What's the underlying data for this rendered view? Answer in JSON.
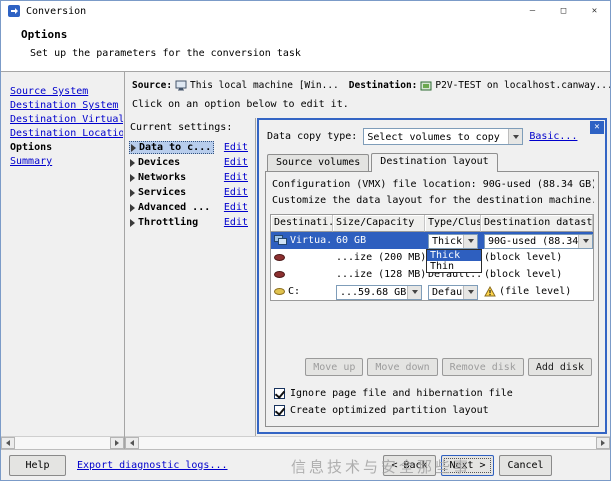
{
  "window": {
    "title": "Conversion",
    "controls": {
      "minimize": "–",
      "maximize": "□",
      "close": "✕"
    }
  },
  "header": {
    "title": "Options",
    "subtitle": "Set up the parameters for the conversion task"
  },
  "sidebar": {
    "items": [
      {
        "label": "Source System"
      },
      {
        "label": "Destination System"
      },
      {
        "label": "Destination Virtual M"
      },
      {
        "label": "Destination Location"
      },
      {
        "label": "Options",
        "current": true
      },
      {
        "label": "Summary"
      }
    ]
  },
  "main": {
    "source_label": "Source:",
    "source_value": "This local machine [Win...",
    "destination_label": "Destination:",
    "destination_value": "P2V-TEST on localhost.canway...",
    "instruction": "Click on an option below to edit it.",
    "settings": {
      "title": "Current settings:",
      "edit_label": "Edit",
      "items": [
        {
          "label": "Data to c...",
          "selected": true
        },
        {
          "label": "Devices"
        },
        {
          "label": "Networks"
        },
        {
          "label": "Services"
        },
        {
          "label": "Advanced ..."
        },
        {
          "label": "Throttling"
        }
      ]
    }
  },
  "panel": {
    "close_glyph": "✕",
    "data_copy_label": "Data copy type:",
    "data_copy_value": "Select volumes to copy",
    "basic_link": "Basic...",
    "tabs": [
      {
        "label": "Source volumes"
      },
      {
        "label": "Destination layout",
        "active": true
      }
    ],
    "config_line": "Configuration (VMX) file location: 90G-used (88.34 GB)",
    "customize_line": "Customize the data layout for the destination machine.",
    "table": {
      "headers": [
        "Destinati...",
        "Size/Capacity",
        "Type/Clus...",
        "Destination datast..."
      ],
      "rows": [
        {
          "name": "Virtua...",
          "size": "60 GB",
          "type": "Thick",
          "datastore": "90G-used (88.34...",
          "selected": true
        },
        {
          "name": "",
          "size": "...ize (200 MB)",
          "type": "",
          "datastore": "(block level)"
        },
        {
          "name": "",
          "size": "...ize (128 MB)",
          "type": "Default...",
          "datastore": "(block level)"
        },
        {
          "name": "C:",
          "size": "...59.68 GB",
          "type": "Defaul...",
          "datastore": "(file level)",
          "warning": true
        }
      ]
    },
    "type_dropdown": {
      "options": [
        {
          "label": "Thick",
          "selected": true
        },
        {
          "label": "Thin"
        }
      ]
    },
    "buttons": [
      {
        "label": "Move up",
        "enabled": false
      },
      {
        "label": "Move down",
        "enabled": false
      },
      {
        "label": "Remove disk",
        "enabled": false
      },
      {
        "label": "Add disk",
        "enabled": true
      }
    ],
    "checkboxes": [
      {
        "label": "Ignore page file and hibernation file",
        "checked": true
      },
      {
        "label": "Create optimized partition layout",
        "checked": true
      }
    ]
  },
  "footer": {
    "help": "Help",
    "export_link": "Export diagnostic logs...",
    "back": "< Back",
    "next": "Next >",
    "cancel": "Cancel",
    "watermark": "信息技术与安全那些事"
  }
}
